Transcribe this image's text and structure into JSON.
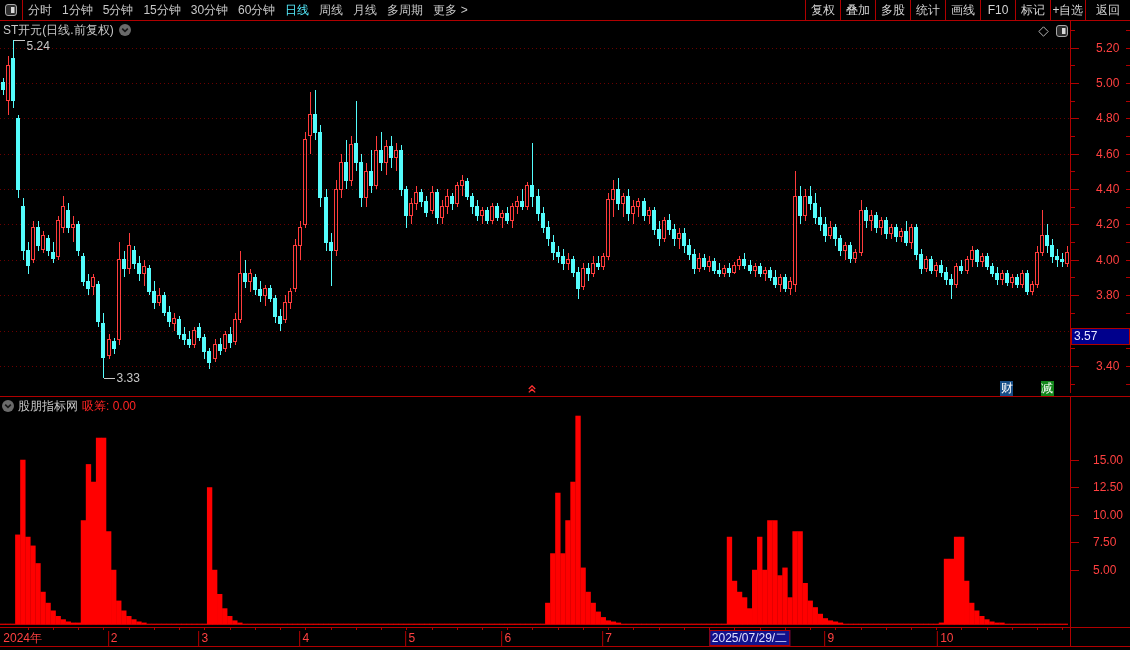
{
  "toolbar": {
    "periods": [
      {
        "label": "分时",
        "selected": false
      },
      {
        "label": "1分钟",
        "selected": false
      },
      {
        "label": "5分钟",
        "selected": false
      },
      {
        "label": "15分钟",
        "selected": false
      },
      {
        "label": "30分钟",
        "selected": false
      },
      {
        "label": "60分钟",
        "selected": false
      },
      {
        "label": "日线",
        "selected": true
      },
      {
        "label": "周线",
        "selected": false
      },
      {
        "label": "月线",
        "selected": false
      },
      {
        "label": "多周期",
        "selected": false
      },
      {
        "label": "更多 >",
        "selected": false
      }
    ],
    "actions": [
      "复权",
      "叠加",
      "多股",
      "统计",
      "画线",
      "F10",
      "标记",
      "+自选",
      "返回"
    ]
  },
  "price_panel": {
    "title": "ST开元(日线.前复权)",
    "high_label": "5.24",
    "low_label": "3.33",
    "events": [
      {
        "label": "财",
        "color": "#164d86"
      },
      {
        "label": "减",
        "color": "#12861a"
      }
    ],
    "axis_labels": [
      "5.20",
      "5.00",
      "4.80",
      "4.60",
      "4.40",
      "4.20",
      "4.00",
      "3.80",
      "3.40"
    ],
    "current_price": "3.57"
  },
  "indicator_panel": {
    "name": "股朋指标网",
    "reading": "吸筹: 0.00",
    "chart_data": {
      "type": "bar",
      "ylim": [
        -0.2,
        20.7
      ],
      "yticks": [
        {
          "value": 5,
          "label": "5.00"
        },
        {
          "value": 7.5,
          "label": "7.50"
        },
        {
          "value": 10,
          "label": "10.00"
        },
        {
          "value": 12.5,
          "label": "12.50"
        },
        {
          "value": 15,
          "label": "15.00"
        }
      ],
      "categories": [
        null,
        null,
        null,
        null,
        "2024年",
        null,
        null,
        null,
        null,
        null,
        null,
        null,
        null,
        null,
        null,
        null,
        null,
        null,
        null,
        null,
        null,
        null,
        "2",
        null,
        null,
        null,
        null,
        null,
        null,
        null,
        null,
        null,
        null,
        null,
        null,
        null,
        null,
        null,
        null,
        null,
        "3",
        null,
        null,
        null,
        null,
        null,
        null,
        null,
        null,
        null,
        null,
        null,
        null,
        null,
        null,
        null,
        null,
        null,
        null,
        null,
        "4",
        null,
        null,
        null,
        null,
        null,
        null,
        null,
        null,
        null,
        null,
        null,
        null,
        null,
        null,
        null,
        null,
        null,
        null,
        null,
        null,
        "5",
        null,
        null,
        null,
        null,
        null,
        null,
        null,
        null,
        null,
        null,
        null,
        null,
        null,
        null,
        null,
        null,
        null,
        null,
        "6",
        null,
        null,
        null,
        null,
        null,
        null,
        null,
        null,
        null,
        null,
        null,
        null,
        null,
        null,
        null,
        null,
        null,
        null,
        null,
        "7",
        null,
        null,
        null,
        null,
        null,
        null,
        null,
        null,
        null,
        null,
        null,
        null,
        null,
        null,
        null,
        null,
        null,
        null,
        null,
        null,
        null,
        null,
        null,
        null,
        null,
        null,
        null,
        null,
        null,
        null,
        null,
        null,
        null,
        null,
        null,
        null,
        null,
        null,
        null,
        null,
        null,
        null,
        null,
        "9",
        null,
        null,
        null,
        null,
        null,
        null,
        null,
        null,
        null,
        null,
        null,
        null,
        null,
        null,
        null,
        null,
        null,
        null,
        null,
        null,
        null,
        null,
        "10",
        null,
        null,
        null,
        null,
        null,
        null,
        null,
        null,
        null,
        null,
        null,
        null,
        null,
        null,
        null,
        null,
        null,
        null,
        null,
        null,
        null,
        null,
        null,
        null
      ],
      "values": [
        0.1,
        0.1,
        0.1,
        8.2,
        15,
        8,
        7.2,
        5.6,
        3,
        2,
        1.3,
        0.8,
        0.5,
        0.3,
        0.2,
        0.2,
        9.5,
        14.6,
        13,
        17,
        17,
        8.5,
        5,
        2.2,
        1.3,
        0.8,
        0.5,
        0.3,
        0.2,
        0.1,
        0.1,
        0.1,
        0.1,
        0.1,
        0.1,
        0.1,
        0.1,
        0.1,
        0.1,
        0.1,
        0.1,
        12.5,
        5,
        2.8,
        1.5,
        0.8,
        0.4,
        0.2,
        0.1,
        0.1,
        0.1,
        0.1,
        0.1,
        0.1,
        0.1,
        0.1,
        0.1,
        0.1,
        0.1,
        0.1,
        0.1,
        0.1,
        0.1,
        0.1,
        0.1,
        0.1,
        0.1,
        0.1,
        0.1,
        0.1,
        0.1,
        0.1,
        0.1,
        0.1,
        0.1,
        0.1,
        0.1,
        0.1,
        0.1,
        0.1,
        0.1,
        0.1,
        0.1,
        0.1,
        0.1,
        0.1,
        0.1,
        0.1,
        0.1,
        0.1,
        0.1,
        0.1,
        0.1,
        0.1,
        0.1,
        0.1,
        0.1,
        0.1,
        0.1,
        0.1,
        0.1,
        0.1,
        0.1,
        0.1,
        0.1,
        0.1,
        0.1,
        0.1,
        2,
        6.5,
        12,
        6.5,
        9.5,
        13,
        19,
        5.2,
        3,
        2,
        1.2,
        0.7,
        0.4,
        0.3,
        0.2,
        0.1,
        0.1,
        0.1,
        0.1,
        0.1,
        0.1,
        0.1,
        0.1,
        0.1,
        0.1,
        0.1,
        0.1,
        0.1,
        0.1,
        0.1,
        0.1,
        0.1,
        0.1,
        0.1,
        0.1,
        0.1,
        8,
        4,
        3,
        2.5,
        1.5,
        5,
        8,
        5,
        9.5,
        9.5,
        4.5,
        5.2,
        2.5,
        8.5,
        8.5,
        3.8,
        2.2,
        1.6,
        1,
        0.6,
        0.4,
        0.3,
        0.2,
        0.1,
        0.1,
        0.1,
        0.1,
        0.1,
        0.1,
        0.1,
        0.1,
        0.1,
        0.1,
        0.1,
        0.1,
        0.1,
        0.1,
        0.1,
        0.1,
        0.1,
        0.1,
        0.1,
        0.2,
        6,
        6,
        8,
        8,
        4,
        2,
        1.3,
        0.8,
        0.5,
        0.3,
        0.2,
        0.2,
        0.1,
        0.1,
        0.1,
        0.1,
        0.1,
        0.1,
        0.1,
        0.1,
        0.1,
        0.1,
        0.1,
        0.1,
        0.1
      ]
    }
  },
  "date_axis": {
    "cursor_label": "2025/07/29/二"
  }
}
